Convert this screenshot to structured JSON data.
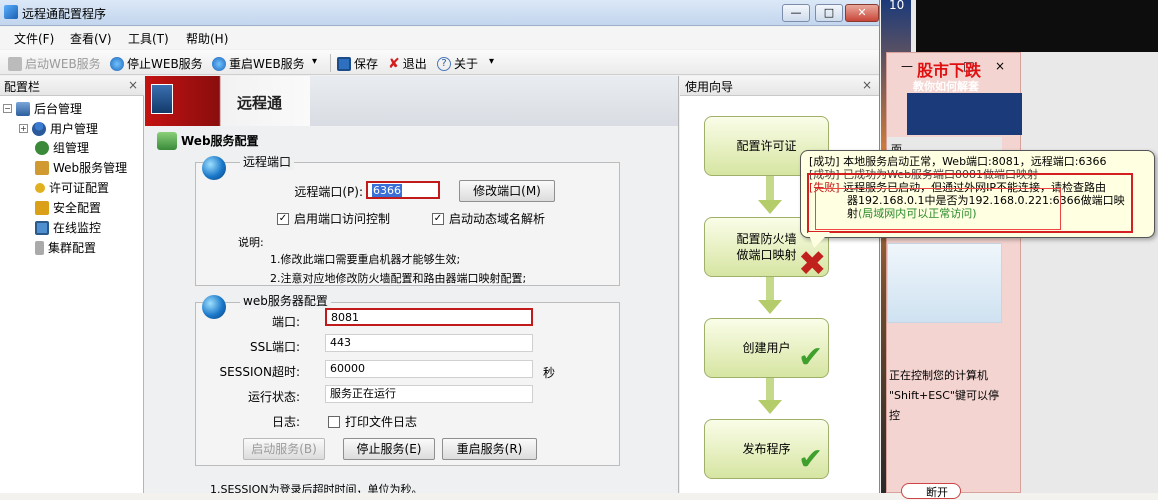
{
  "window": {
    "title": "远程通配置程序",
    "menu": [
      "文件(F)",
      "查看(V)",
      "工具(T)",
      "帮助(H)"
    ],
    "toolbar": {
      "start_web": "启动WEB服务",
      "stop_web": "停止WEB服务",
      "restart_web": "重启WEB服务",
      "save": "保存",
      "exit": "退出",
      "about": "关于",
      "dropdown_glyph": "▾"
    }
  },
  "left_panel": {
    "title": "配置栏",
    "close": "×",
    "root": "后台管理",
    "items": [
      "用户管理",
      "组管理",
      "Web服务管理",
      "许可证配置",
      "安全配置",
      "在线监控",
      "集群配置"
    ]
  },
  "center": {
    "logo_text": "远程通",
    "section_title": "Web服务配置",
    "remote_group": {
      "title": "远程端口",
      "port_label": "远程端口(P):",
      "port_value": "6366",
      "modify_button": "修改端口(M)",
      "chk_access": "启用端口访问控制",
      "chk_ddns": "启动动态域名解析",
      "note_title": "说明:",
      "note1": "1.修改此端口需要重启机器才能够生效;",
      "note2": "2.注意对应地修改防火墙配置和路由器端口映射配置;"
    },
    "web_group": {
      "title": "web服务器配置",
      "port_label": "端口:",
      "port_value": "8081",
      "ssl_label": "SSL端口:",
      "ssl_value": "443",
      "session_label": "SESSION超时:",
      "session_value": "60000",
      "session_unit": "秒",
      "status_label": "运行状态:",
      "status_value": "服务正在运行",
      "log_label": "日志:",
      "log_check": "打印文件日志",
      "btn_start": "启动服务(B)",
      "btn_stop": "停止服务(E)",
      "btn_restart": "重启服务(R)"
    },
    "footer_note": "1.SESSION为登录后超时时间，单位为秒。"
  },
  "wizard": {
    "title": "使用向导",
    "close": "×",
    "steps": [
      "配置许可证",
      "配置防火墙\n做端口映射",
      "创建用户",
      "发布程序"
    ]
  },
  "tooltip": {
    "line1": "[成功] 本地服务启动正常，Web端口:8081，远程端口:6366",
    "line2": "[成功] 已成功为Web服务端口8081做端口映射",
    "line3_tag": "[失败]",
    "line3": " 远程服务已启动，但通过外网IP不能连接，请检查路由",
    "line4": "器192.168.0.1中是否为192.168.0.221:6366做端口映",
    "line5a": "射",
    "line5b": "(局域网内可以正常访问)"
  },
  "desktop": {
    "corner_number": "10",
    "popup_controls": [
      "—",
      "□",
      "×"
    ],
    "ad_line1": "股市下跌",
    "ad_line2": "教你如何解套",
    "side_text1": "面",
    "text1": "正在控制您的计算机",
    "text2": "\"Shift+ESC\"键可以停",
    "text3": "控",
    "disconnect": "断开"
  },
  "colors": {
    "accent_red": "#c01a1a",
    "success_green": "#3fa02e",
    "wizard_fill": "#d6e5a2"
  }
}
